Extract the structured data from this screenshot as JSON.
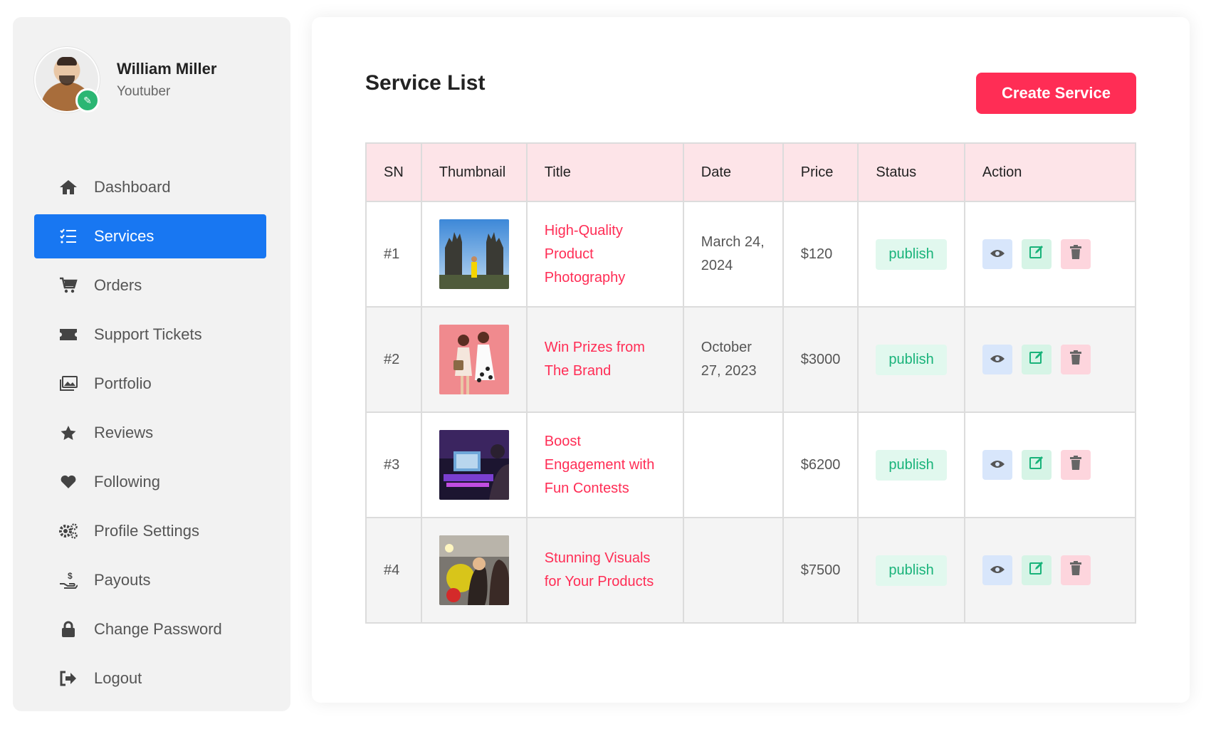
{
  "profile": {
    "name": "William Miller",
    "role": "Youtuber"
  },
  "sidebar": {
    "items": [
      {
        "label": "Dashboard",
        "icon": "home-icon",
        "active": false
      },
      {
        "label": "Services",
        "icon": "list-check-icon",
        "active": true
      },
      {
        "label": "Orders",
        "icon": "cart-icon",
        "active": false
      },
      {
        "label": "Support Tickets",
        "icon": "ticket-icon",
        "active": false
      },
      {
        "label": "Portfolio",
        "icon": "images-icon",
        "active": false
      },
      {
        "label": "Reviews",
        "icon": "star-icon",
        "active": false
      },
      {
        "label": "Following",
        "icon": "heart-icon",
        "active": false
      },
      {
        "label": "Profile Settings",
        "icon": "gears-icon",
        "active": false
      },
      {
        "label": "Payouts",
        "icon": "hand-dollar-icon",
        "active": false
      },
      {
        "label": "Change Password",
        "icon": "lock-icon",
        "active": false
      },
      {
        "label": "Logout",
        "icon": "sign-out-icon",
        "active": false
      }
    ]
  },
  "main": {
    "title": "Service List",
    "create_label": "Create Service",
    "table": {
      "headers": [
        "SN",
        "Thumbnail",
        "Title",
        "Date",
        "Price",
        "Status",
        "Action"
      ],
      "rows": [
        {
          "sn": "#1",
          "title": "High-Quality Product Photography",
          "date": "March 24, 2024",
          "price": "$120",
          "status": "publish"
        },
        {
          "sn": "#2",
          "title": "Win Prizes from The Brand",
          "date": "October 27, 2023",
          "price": "$3000",
          "status": "publish"
        },
        {
          "sn": "#3",
          "title": "Boost Engagement with Fun Contests",
          "date": "",
          "price": "$6200",
          "status": "publish"
        },
        {
          "sn": "#4",
          "title": "Stunning Visuals for Your Products",
          "date": "",
          "price": "$7500",
          "status": "publish"
        }
      ]
    }
  },
  "colors": {
    "accent_blue": "#1877f2",
    "brand_red": "#ff2d55",
    "status_green": "#19b37a",
    "header_pink": "#fde4e8"
  }
}
